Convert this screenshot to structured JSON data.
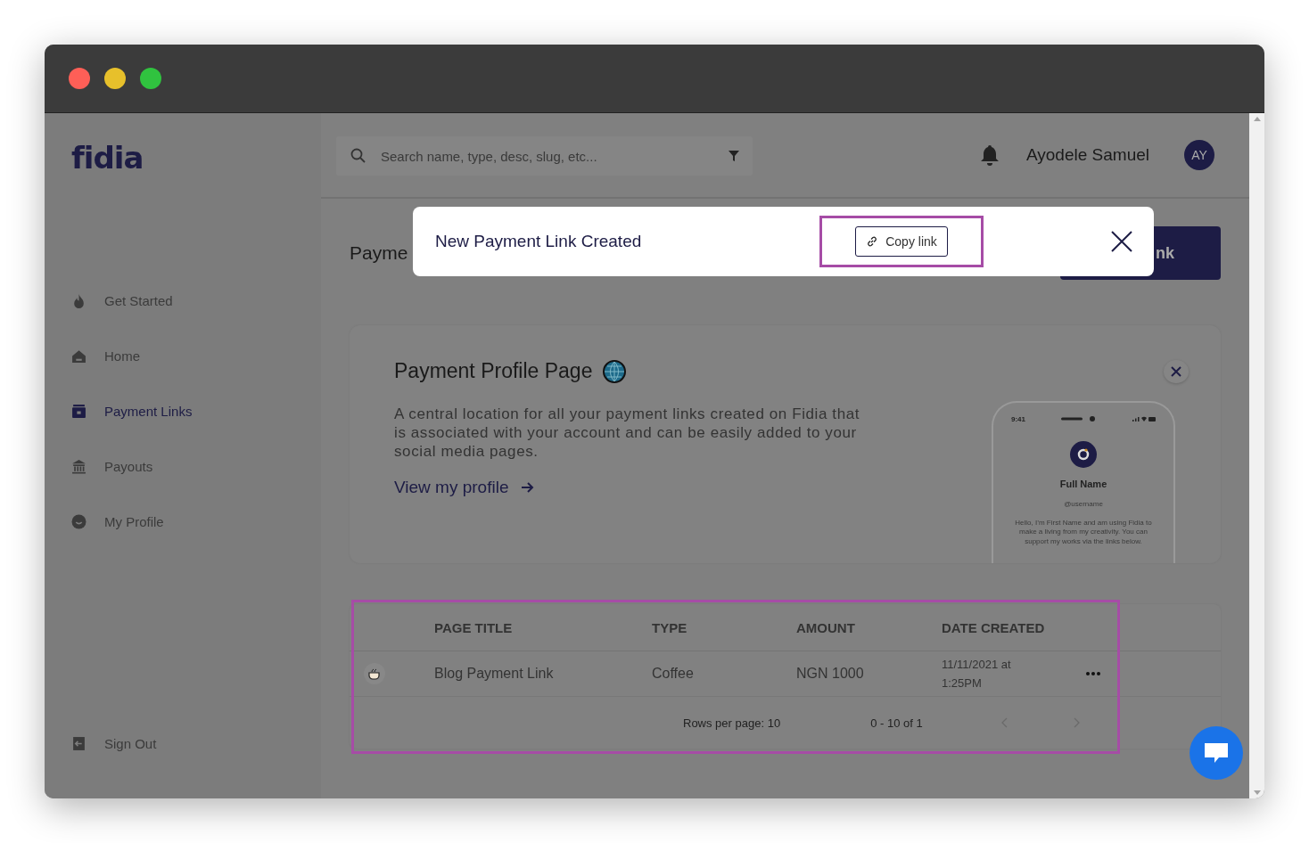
{
  "logo": "fidia",
  "sidebar": {
    "items": [
      {
        "label": "Get Started",
        "selected": false
      },
      {
        "label": "Home",
        "selected": false
      },
      {
        "label": "Payment Links",
        "selected": true
      },
      {
        "label": "Payouts",
        "selected": false
      },
      {
        "label": "My Profile",
        "selected": false
      }
    ],
    "footer_item": {
      "label": "Sign Out"
    }
  },
  "header": {
    "search": {
      "placeholder": "Search name, type, desc, slug, etc..."
    },
    "user_name": "Ayodele Samuel",
    "avatar_initials": "AY"
  },
  "page": {
    "title": "Payme",
    "primary_button": "nk"
  },
  "toast": {
    "message": "New Payment Link Created",
    "copy_button": "Copy link"
  },
  "profile_card": {
    "title": "Payment Profile Page",
    "description": "A central location for all your payment links created on Fidia that is associated with your account and can be easily added to your social media pages.",
    "link": "View my profile",
    "phone_preview": {
      "time": "9:41",
      "name": "Full Name",
      "username": "@username",
      "bio": "Hello, I’m First Name and am using Fidia to make a living from my creativity. You can support my works via the links below."
    }
  },
  "table": {
    "columns": [
      "PAGE TITLE",
      "TYPE",
      "AMOUNT",
      "DATE CREATED"
    ],
    "rows": [
      {
        "cells": [
          "Blog Payment Link",
          "Coffee",
          "NGN 1000",
          "11/11/2021 at 1:25PM"
        ]
      }
    ],
    "footer": {
      "rows_per_page": "Rows per page: 10",
      "range": "0 - 10 of 1"
    }
  }
}
